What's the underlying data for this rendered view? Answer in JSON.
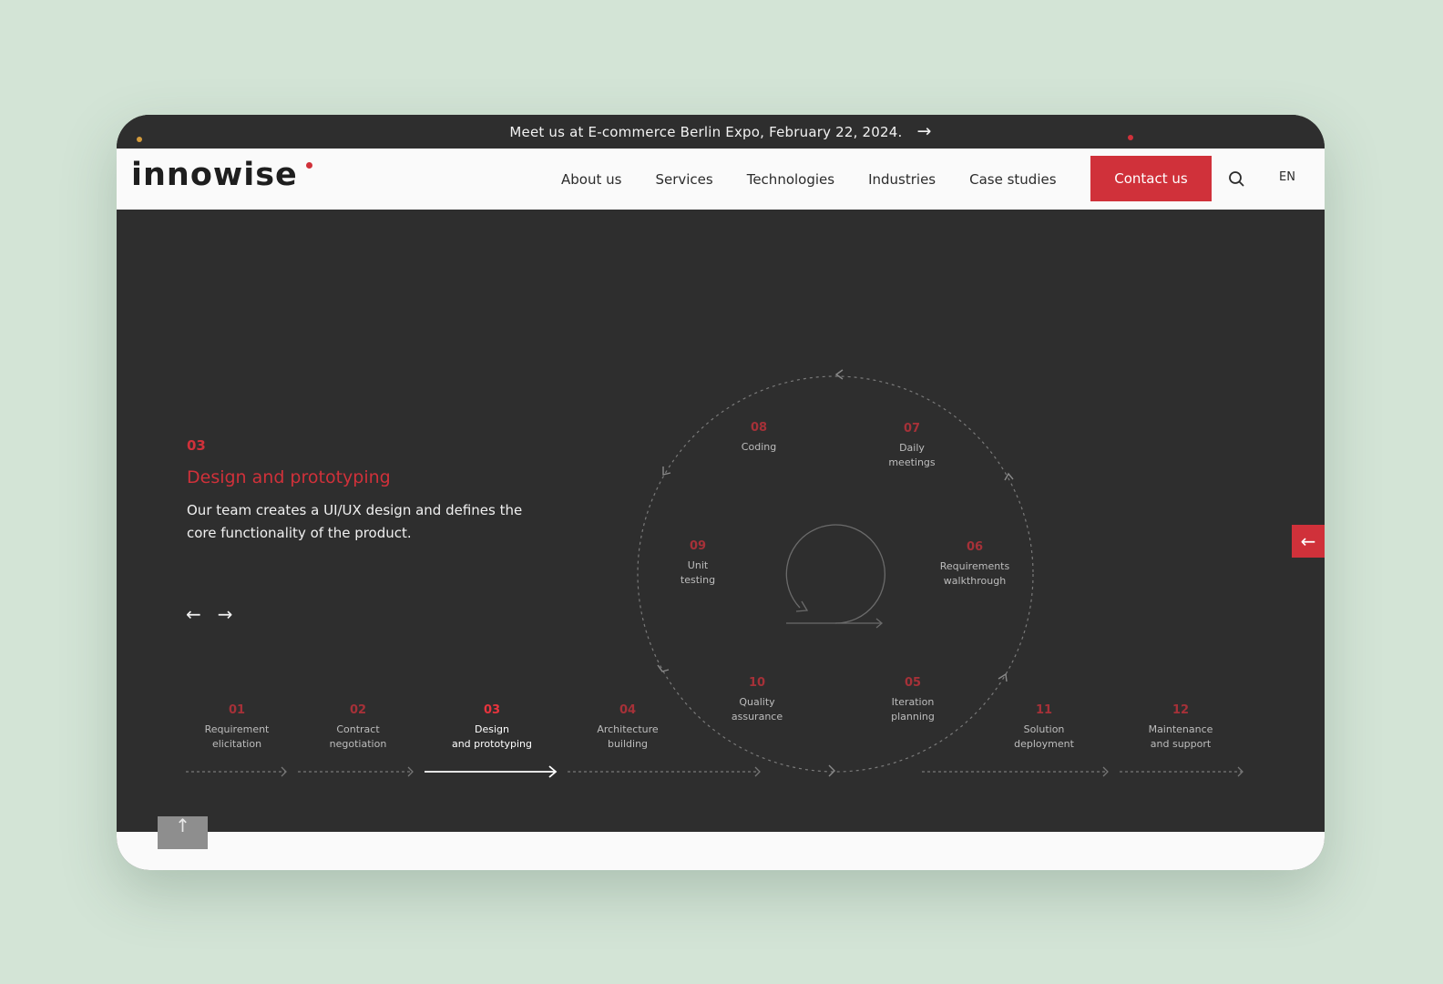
{
  "banner": {
    "text": "Meet us at E-commerce Berlin Expo, February 22, 2024.",
    "arrow": "→"
  },
  "brand": {
    "logo_text": "innowise",
    "accent": "#d0313a"
  },
  "nav": {
    "items": [
      {
        "label": "About us"
      },
      {
        "label": "Services"
      },
      {
        "label": "Technologies"
      },
      {
        "label": "Industries"
      },
      {
        "label": "Case studies"
      }
    ],
    "contact_label": "Contact us",
    "lang": "EN"
  },
  "current_step": {
    "number": "03",
    "title": "Design and prototyping",
    "description": "Our team creates a UI/UX design and defines the core functionality of the product."
  },
  "controls": {
    "prev": "←",
    "next": "→",
    "side_tab": "←",
    "to_top": "↑"
  },
  "timeline": [
    {
      "num": "01",
      "label_1": "Requirement",
      "label_2": "elicitation"
    },
    {
      "num": "02",
      "label_1": "Contract",
      "label_2": "negotiation"
    },
    {
      "num": "03",
      "label_1": "Design",
      "label_2": "and prototyping"
    },
    {
      "num": "04",
      "label_1": "Architecture",
      "label_2": "building"
    },
    {
      "num": "11",
      "label_1": "Solution",
      "label_2": "deployment"
    },
    {
      "num": "12",
      "label_1": "Maintenance",
      "label_2": "and support"
    }
  ],
  "cycle": [
    {
      "num": "05",
      "label_1": "Iteration",
      "label_2": "planning"
    },
    {
      "num": "06",
      "label_1": "Requirements",
      "label_2": "walkthrough"
    },
    {
      "num": "07",
      "label_1": "Daily",
      "label_2": "meetings"
    },
    {
      "num": "08",
      "label_1": "Coding",
      "label_2": ""
    },
    {
      "num": "09",
      "label_1": "Unit",
      "label_2": "testing"
    },
    {
      "num": "10",
      "label_1": "Quality",
      "label_2": "assurance"
    }
  ]
}
